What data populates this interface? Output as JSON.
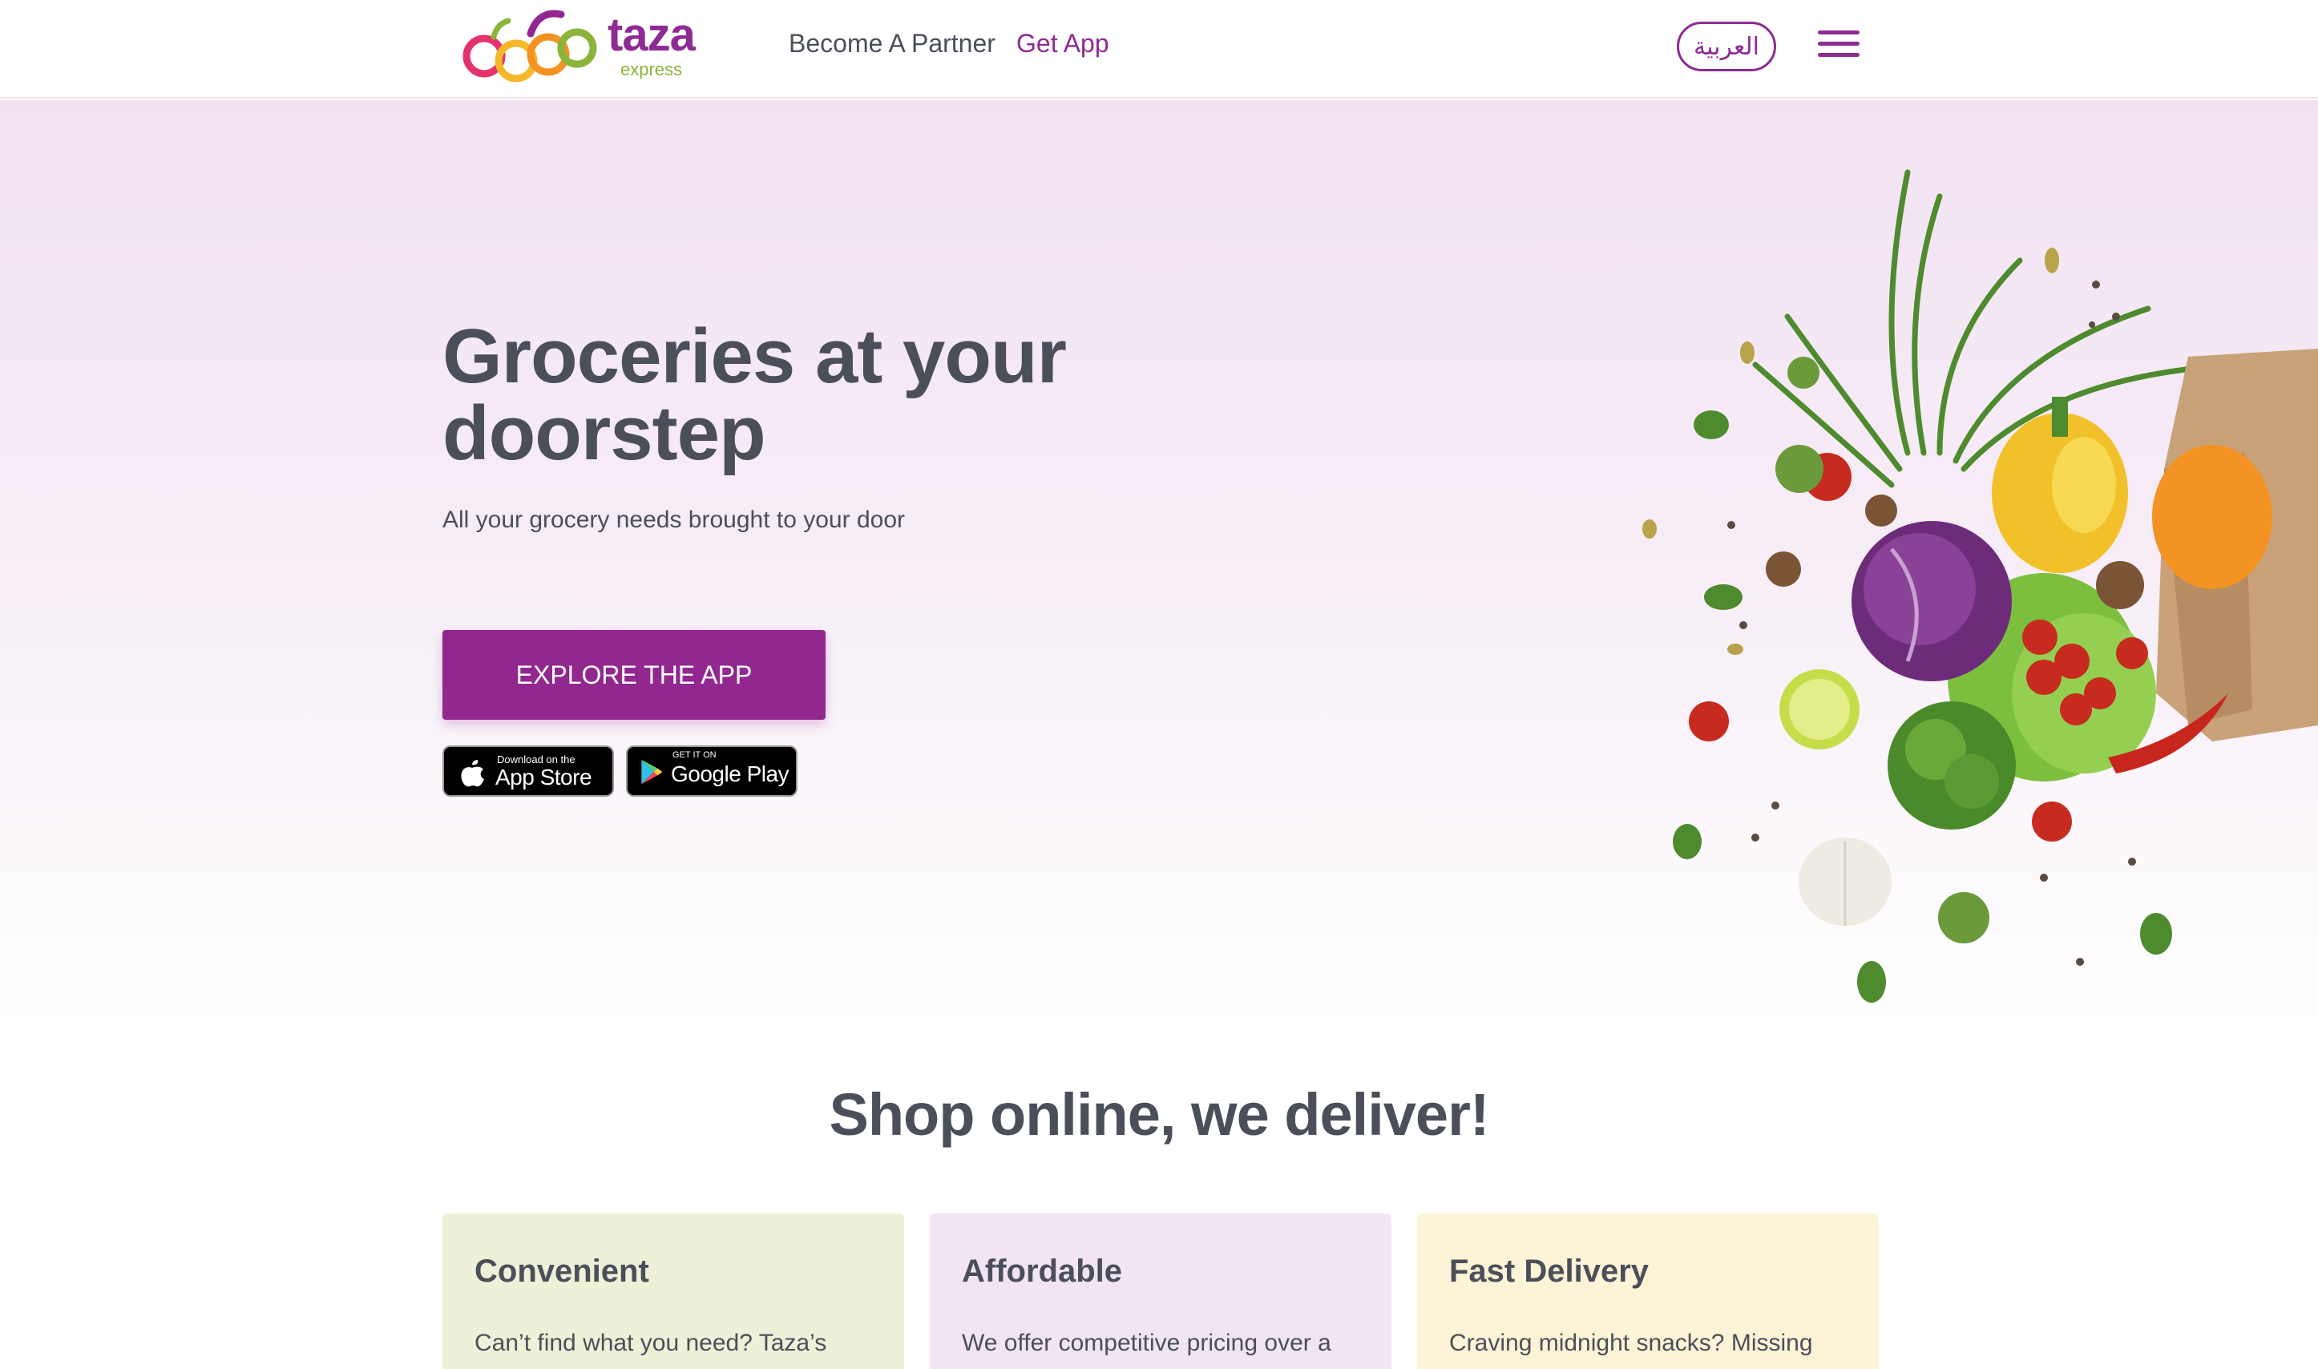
{
  "brand": {
    "name": "taza",
    "sub": "express",
    "color": "#8e2b93",
    "accent": "#8bb43a"
  },
  "nav": {
    "partner": "Become A Partner",
    "get_app": "Get App",
    "language": "العربية",
    "menu_icon": "hamburger-icon"
  },
  "hero": {
    "title": "Groceries at your doorstep",
    "subtitle": "All your grocery needs brought to your door",
    "cta": "EXPLORE THE APP",
    "app_store": {
      "small": "Download on the",
      "big": "App Store",
      "icon": "apple-icon"
    },
    "google_play": {
      "small": "GET IT ON",
      "big": "Google Play",
      "icon": "google-play-icon"
    }
  },
  "features": {
    "title": "Shop online, we deliver!",
    "cards": [
      {
        "title": "Convenient",
        "text": "Can’t find what you need? Taza’s",
        "color": "#eef0d8"
      },
      {
        "title": "Affordable",
        "text": "We offer competitive pricing over a",
        "color": "#f2e5f3"
      },
      {
        "title": "Fast Delivery",
        "text": "Craving midnight snacks? Missing",
        "color": "#fdf3d6"
      }
    ]
  }
}
